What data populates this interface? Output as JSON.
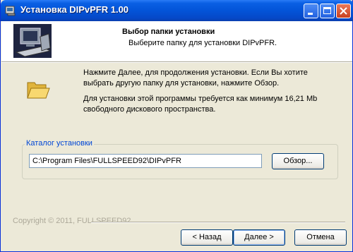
{
  "window": {
    "title": "Установка DIPvPFR 1.00"
  },
  "header": {
    "title": "Выбор папки установки",
    "subtitle": "Выберите папку для установки DIPvPFR."
  },
  "body": {
    "instruction": "Нажмите Далее, для продолжения установки. Если Вы хотите выбрать другую папку для установки, нажмите Обзор.",
    "space_required": "Для установки этой программы требуется как минимум 16,21 Mb свободного дискового пространства."
  },
  "install_dir": {
    "group_label": "Каталог установки",
    "path": "C:\\Program Files\\FULLSPEED92\\DIPvPFR",
    "browse_label": "Обзор..."
  },
  "footer": {
    "copyright": "Copyright © 2011, FULLSPEED92",
    "back_label": "< Назад",
    "next_label": "Далее >",
    "cancel_label": "Отмена"
  },
  "icons": {
    "title_icon": "setup-app-icon",
    "header_art": "computer-setup-icon",
    "folder": "open-folder-icon",
    "minimize": "minimize-icon",
    "maximize": "maximize-icon",
    "close": "close-icon"
  },
  "colors": {
    "titlebar": "#0A5FE4",
    "dialog_bg": "#ECE9D8",
    "group_label": "#0046D5",
    "copyright": "#ACA899"
  }
}
